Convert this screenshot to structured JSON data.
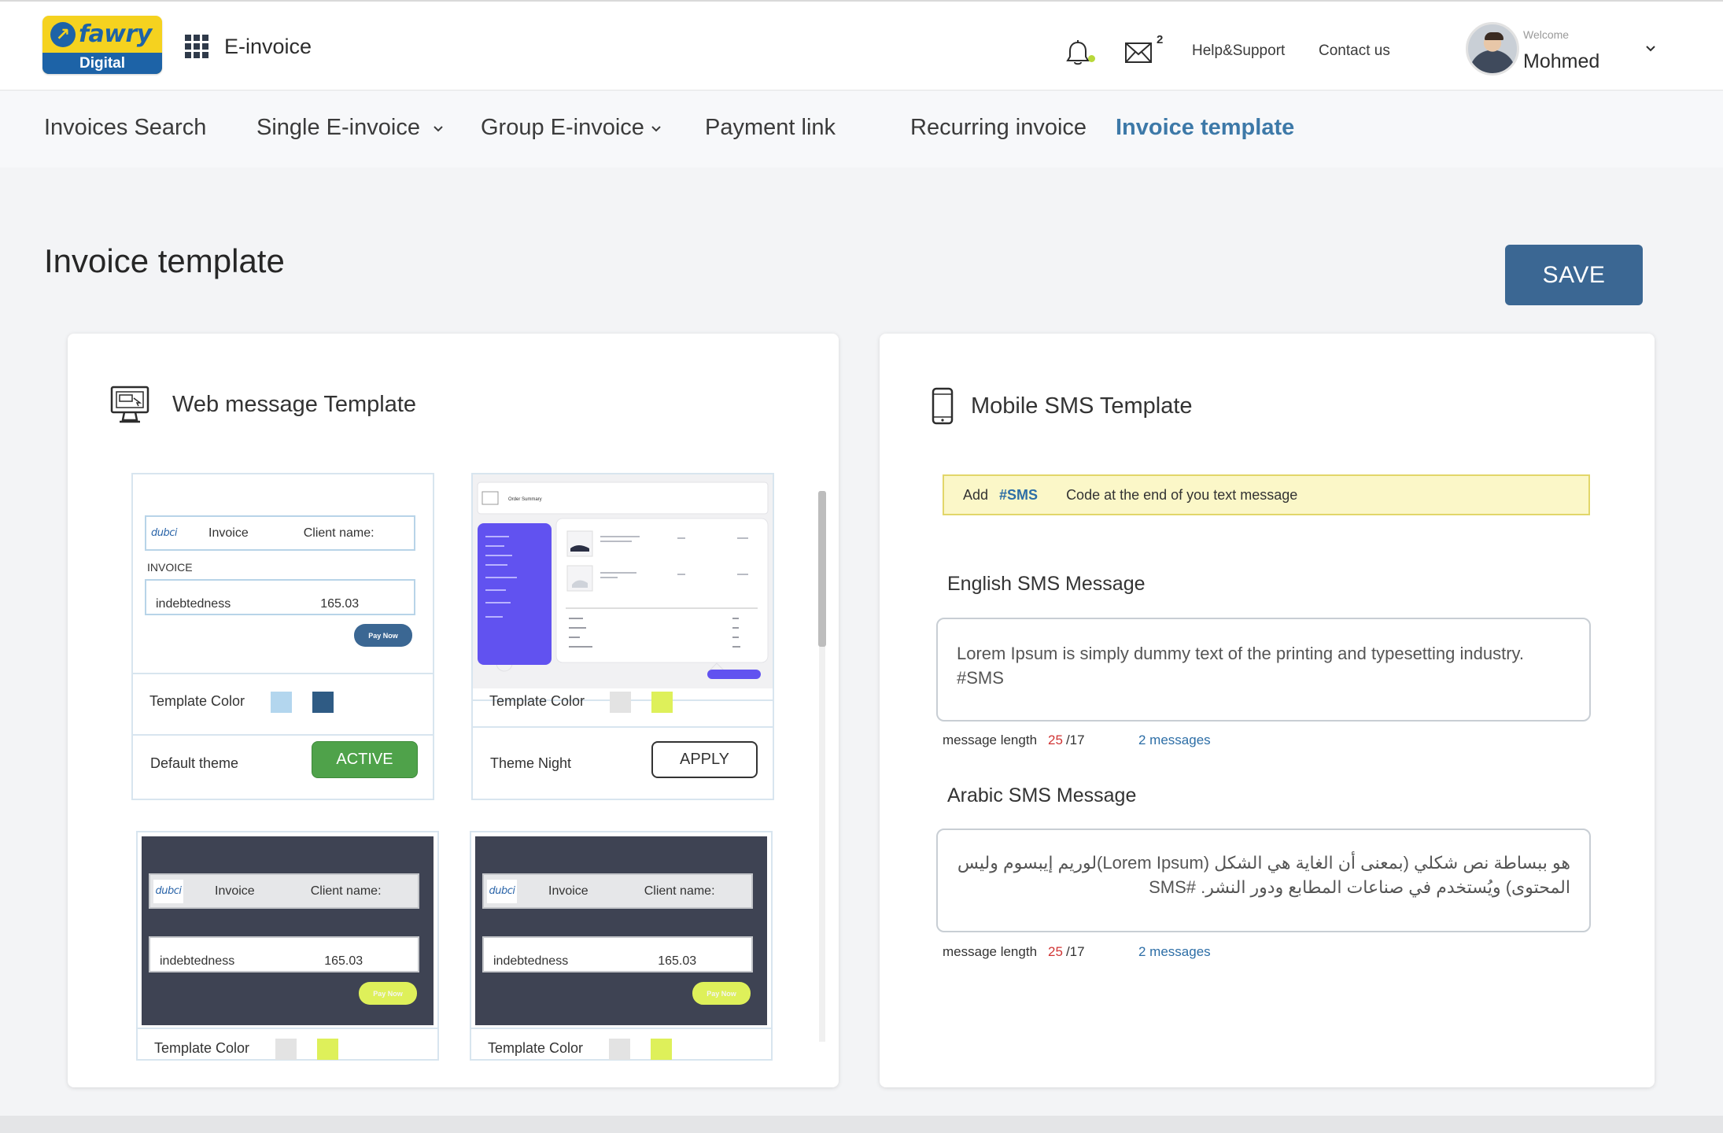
{
  "header": {
    "logo_text": "fawry",
    "logo_subtext": "Digital",
    "app_title": "E-invoice",
    "mail_count": "2",
    "help_link": "Help&Support",
    "contact_link": "Contact us",
    "welcome_label": "Welcome",
    "user_name": "Mohmed"
  },
  "nav": {
    "items": [
      {
        "label": "Invoices Search"
      },
      {
        "label": "Single E-invoice"
      },
      {
        "label": "Group E-invoice"
      },
      {
        "label": "Payment link"
      },
      {
        "label": "Recurring invoice"
      },
      {
        "label": "Invoice template"
      }
    ],
    "active": "Invoice template"
  },
  "page": {
    "title": "Invoice template",
    "save_label": "SAVE"
  },
  "web_template": {
    "title": "Web message Template",
    "templates": [
      {
        "brand": "dubci",
        "invoice_label": "Invoice",
        "client_label": "Client name:",
        "invoice_heading": "INVOICE",
        "row_label": "indebtedness",
        "row_amount": "165.03",
        "pay_label": "Pay Now",
        "color_label": "Template Color",
        "colors": [
          "#b3d6ee",
          "#2f5b84"
        ],
        "theme_name": "Default theme",
        "action_label": "ACTIVE"
      },
      {
        "mock_heading": "Order Summary",
        "color_label": "Template Color",
        "colors": [
          "#e3e3e3",
          "#def05a"
        ],
        "theme_name": "Theme Night",
        "action_label": "APPLY"
      },
      {
        "brand": "dubci",
        "invoice_label": "Invoice",
        "client_label": "Client name:",
        "row_label": "indebtedness",
        "row_amount": "165.03",
        "pay_label": "Pay Now",
        "color_label": "Template Color",
        "colors": [
          "#e3e3e3",
          "#def05a"
        ]
      },
      {
        "brand": "dubci",
        "invoice_label": "Invoice",
        "client_label": "Client name:",
        "row_label": "indebtedness",
        "row_amount": "165.03",
        "pay_label": "Pay Now",
        "color_label": "Template Color",
        "colors": [
          "#e3e3e3",
          "#def05a"
        ]
      }
    ]
  },
  "sms_template": {
    "title": "Mobile SMS Template",
    "note_prefix": "Add",
    "note_code": "#SMS",
    "note_suffix": "Code  at the end of you text message",
    "english": {
      "label": "English SMS Message",
      "text": "Lorem Ipsum is simply dummy text of the printing and typesetting industry. #SMS",
      "length_label": "message length",
      "length_value": "25",
      "length_max": "/17",
      "messages": "2 messages"
    },
    "arabic": {
      "label": "Arabic SMS Message",
      "text": "هو ببساطة نص شكلي (بمعنى أن الغاية هي الشكل (Lorem Ipsum)لوريم إيبسوم وليس المحتوى) ويُستخدم في صناعات المطابع ودور النشر. #SMS",
      "length_label": "message length",
      "length_value": "25",
      "length_max": "/17",
      "messages": "2 messages"
    }
  },
  "colors": {
    "accent": "#3d79a8",
    "save_button": "#3b6793",
    "active_button": "#4fa24a",
    "note_bg": "#fbf7c8"
  }
}
